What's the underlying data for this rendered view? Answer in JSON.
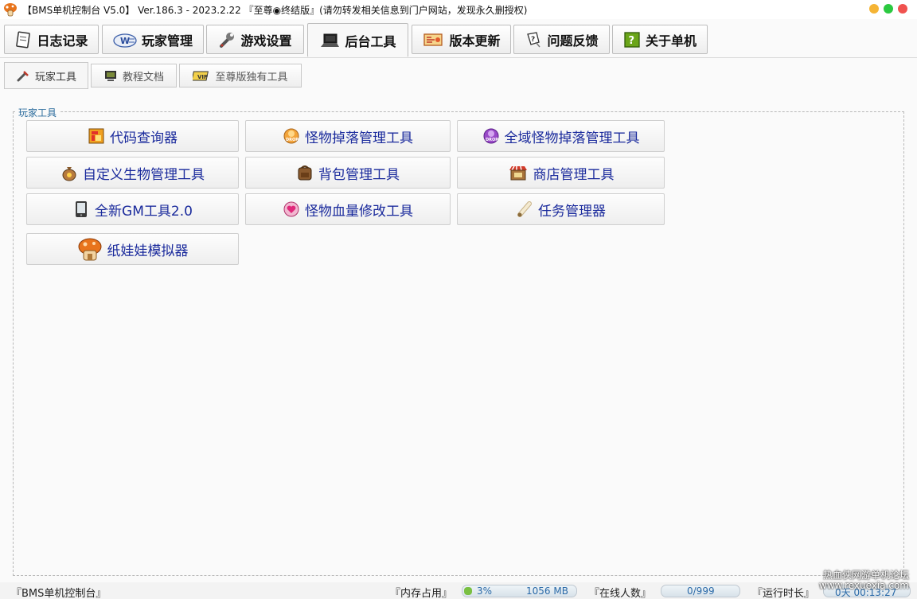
{
  "titlebar": {
    "title": "【BMS单机控制台 V5.0】 Ver.186.3 - 2023.2.22 『至尊◉终结版』(请勿转发相关信息到门户网站，发现永久删授权)",
    "app_icon": "mushroom-icon",
    "window_controls": {
      "minimize_color": "#f5b434",
      "maximize_color": "#2bc940",
      "close_color": "#f0524f"
    }
  },
  "main_tabs": [
    {
      "label": "日志记录",
      "icon": "notebook-icon"
    },
    {
      "label": "玩家管理",
      "icon": "word-doc-icon"
    },
    {
      "label": "游戏设置",
      "icon": "wrench-icon"
    },
    {
      "label": "后台工具",
      "icon": "laptop-icon",
      "active": true
    },
    {
      "label": "版本更新",
      "icon": "scroll-map-icon"
    },
    {
      "label": "问题反馈",
      "icon": "question-bubble-icon"
    },
    {
      "label": "关于单机",
      "icon": "help-book-icon"
    }
  ],
  "sub_tabs": [
    {
      "label": "玩家工具",
      "icon": "tools-icon",
      "active": true
    },
    {
      "label": "教程文档",
      "icon": "monitor-icon"
    },
    {
      "label": "至尊版独有工具",
      "icon": "vip-card-icon"
    }
  ],
  "group": {
    "legend": "玩家工具",
    "buttons": [
      {
        "label": "代码查询器",
        "icon": "code-grid-icon"
      },
      {
        "label": "怪物掉落管理工具",
        "icon": "drop-orange-icon"
      },
      {
        "label": "全域怪物掉落管理工具",
        "icon": "drop-purple-icon"
      },
      {
        "label": "自定义生物管理工具",
        "icon": "money-bag-icon"
      },
      {
        "label": "背包管理工具",
        "icon": "backpack-icon"
      },
      {
        "label": "商店管理工具",
        "icon": "shop-icon"
      },
      {
        "label": "全新GM工具2.0",
        "icon": "phone-device-icon"
      },
      {
        "label": "怪物血量修改工具",
        "icon": "heart-potion-icon"
      },
      {
        "label": "任务管理器",
        "icon": "quest-scroll-icon"
      },
      {
        "label": "纸娃娃模拟器",
        "icon": "mushroom-house-icon"
      }
    ]
  },
  "statusbar": {
    "app_label": "『BMS单机控制台』",
    "memory_label": "『内存占用』",
    "memory_percent": "3%",
    "memory_value": "1056 MB",
    "memory_fraction": 0.03,
    "online_label": "『在线人数』",
    "online_value": "0/999",
    "runtime_label": "『运行时长』",
    "runtime_value": "0天 00:13:27"
  },
  "watermark": {
    "line1": "热血侠网游单机论坛",
    "line2": "www.rexuexia.com"
  }
}
